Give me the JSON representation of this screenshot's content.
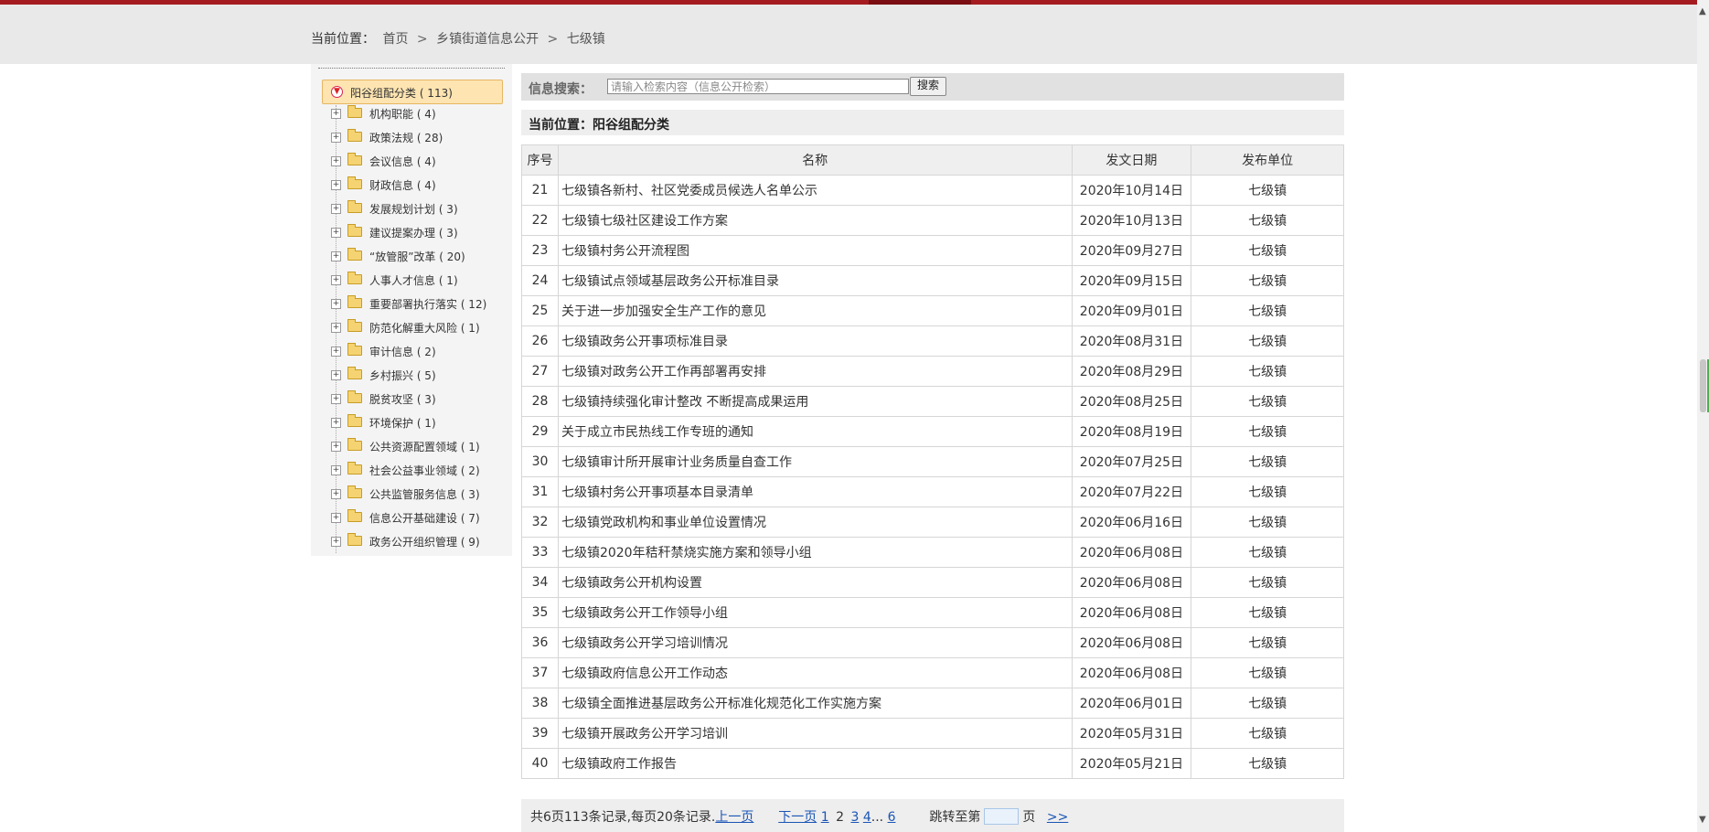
{
  "breadcrumb": {
    "label": "当前位置：",
    "items": [
      "首页",
      "乡镇街道信息公开",
      "七级镇"
    ],
    "sep": ">"
  },
  "sidebar": {
    "root": "阳谷组配分类 ( 113)",
    "items": [
      {
        "label": "机构职能 ( 4)"
      },
      {
        "label": "政策法规 ( 28)"
      },
      {
        "label": "会议信息 ( 4)"
      },
      {
        "label": "财政信息 ( 4)"
      },
      {
        "label": "发展规划计划 ( 3)"
      },
      {
        "label": "建议提案办理 ( 3)"
      },
      {
        "label": "“放管服”改革 ( 20)"
      },
      {
        "label": "人事人才信息 ( 1)"
      },
      {
        "label": "重要部署执行落实 ( 12)"
      },
      {
        "label": "防范化解重大风险 ( 1)"
      },
      {
        "label": "审计信息 ( 2)"
      },
      {
        "label": "乡村振兴 ( 5)"
      },
      {
        "label": "脱贫攻坚 ( 3)"
      },
      {
        "label": "环境保护 ( 1)"
      },
      {
        "label": "公共资源配置领域 ( 1)"
      },
      {
        "label": "社会公益事业领域 ( 2)"
      },
      {
        "label": "公共监管服务信息 ( 3)"
      },
      {
        "label": "信息公开基础建设 ( 7)"
      },
      {
        "label": "政务公开组织管理 ( 9)"
      }
    ]
  },
  "search": {
    "label": "信息搜索：",
    "placeholder": "请输入检索内容（信息公开检索）",
    "button": "搜索"
  },
  "location": {
    "text": "当前位置：阳谷组配分类"
  },
  "table": {
    "headers": {
      "num": "序号",
      "title": "名称",
      "date": "发文日期",
      "org": "发布单位"
    },
    "rows": [
      {
        "num": "21",
        "title": "七级镇各新村、社区党委成员候选人名单公示",
        "date": "2020年10月14日",
        "org": "七级镇"
      },
      {
        "num": "22",
        "title": "七级镇七级社区建设工作方案",
        "date": "2020年10月13日",
        "org": "七级镇"
      },
      {
        "num": "23",
        "title": "七级镇村务公开流程图",
        "date": "2020年09月27日",
        "org": "七级镇"
      },
      {
        "num": "24",
        "title": "七级镇试点领域基层政务公开标准目录",
        "date": "2020年09月15日",
        "org": "七级镇"
      },
      {
        "num": "25",
        "title": "关于进一步加强安全生产工作的意见",
        "date": "2020年09月01日",
        "org": "七级镇"
      },
      {
        "num": "26",
        "title": "七级镇政务公开事项标准目录",
        "date": "2020年08月31日",
        "org": "七级镇"
      },
      {
        "num": "27",
        "title": "七级镇对政务公开工作再部署再安排",
        "date": "2020年08月29日",
        "org": "七级镇"
      },
      {
        "num": "28",
        "title": "七级镇持续强化审计整改 不断提高成果运用",
        "date": "2020年08月25日",
        "org": "七级镇"
      },
      {
        "num": "29",
        "title": "关于成立市民热线工作专班的通知",
        "date": "2020年08月19日",
        "org": "七级镇"
      },
      {
        "num": "30",
        "title": "七级镇审计所开展审计业务质量自查工作",
        "date": "2020年07月25日",
        "org": "七级镇"
      },
      {
        "num": "31",
        "title": "七级镇村务公开事项基本目录清单",
        "date": "2020年07月22日",
        "org": "七级镇"
      },
      {
        "num": "32",
        "title": "七级镇党政机构和事业单位设置情况",
        "date": "2020年06月16日",
        "org": "七级镇"
      },
      {
        "num": "33",
        "title": "七级镇2020年秸秆禁烧实施方案和领导小组",
        "date": "2020年06月08日",
        "org": "七级镇"
      },
      {
        "num": "34",
        "title": "七级镇政务公开机构设置",
        "date": "2020年06月08日",
        "org": "七级镇"
      },
      {
        "num": "35",
        "title": "七级镇政务公开工作领导小组",
        "date": "2020年06月08日",
        "org": "七级镇"
      },
      {
        "num": "36",
        "title": "七级镇政务公开学习培训情况",
        "date": "2020年06月08日",
        "org": "七级镇"
      },
      {
        "num": "37",
        "title": "七级镇政府信息公开工作动态",
        "date": "2020年06月08日",
        "org": "七级镇"
      },
      {
        "num": "38",
        "title": "七级镇全面推进基层政务公开标准化规范化工作实施方案",
        "date": "2020年06月01日",
        "org": "七级镇"
      },
      {
        "num": "39",
        "title": "七级镇开展政务公开学习培训",
        "date": "2020年05月31日",
        "org": "七级镇"
      },
      {
        "num": "40",
        "title": "七级镇政府工作报告",
        "date": "2020年05月21日",
        "org": "七级镇"
      }
    ]
  },
  "pagination": {
    "summary": "共6页113条记录,每页20条记录.",
    "prev": "上一页",
    "next": "下一页",
    "pages": [
      "1",
      "2",
      "3",
      "4",
      "...",
      "6"
    ],
    "current": "2",
    "jump_label": "跳转至第",
    "jump_suffix": "页",
    "go": ">>"
  }
}
